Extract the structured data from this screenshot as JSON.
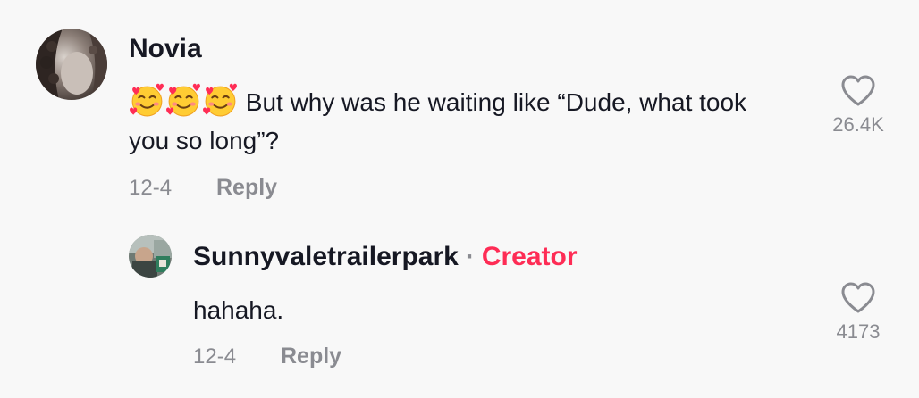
{
  "comments": [
    {
      "username": "Novia",
      "emoji_count": 3,
      "text": "But why was he waiting like “Dude, what took you so long”?",
      "date": "12-4",
      "reply_label": "Reply",
      "like_count": "26.4K"
    }
  ],
  "replies": [
    {
      "username": "Sunnyvaletrailerpark",
      "separator": "·",
      "badge": "Creator",
      "text": "hahaha.",
      "date": "12-4",
      "reply_label": "Reply",
      "like_count": "4173"
    }
  ],
  "colors": {
    "background": "#f8f8f8",
    "text_primary": "#161823",
    "text_secondary": "#8a8b91",
    "creator_badge": "#fe2c55",
    "icon_stroke": "#8a8b91"
  },
  "icons": {
    "emoji": "smiling-face-with-hearts-icon",
    "like": "heart-outline-icon"
  }
}
